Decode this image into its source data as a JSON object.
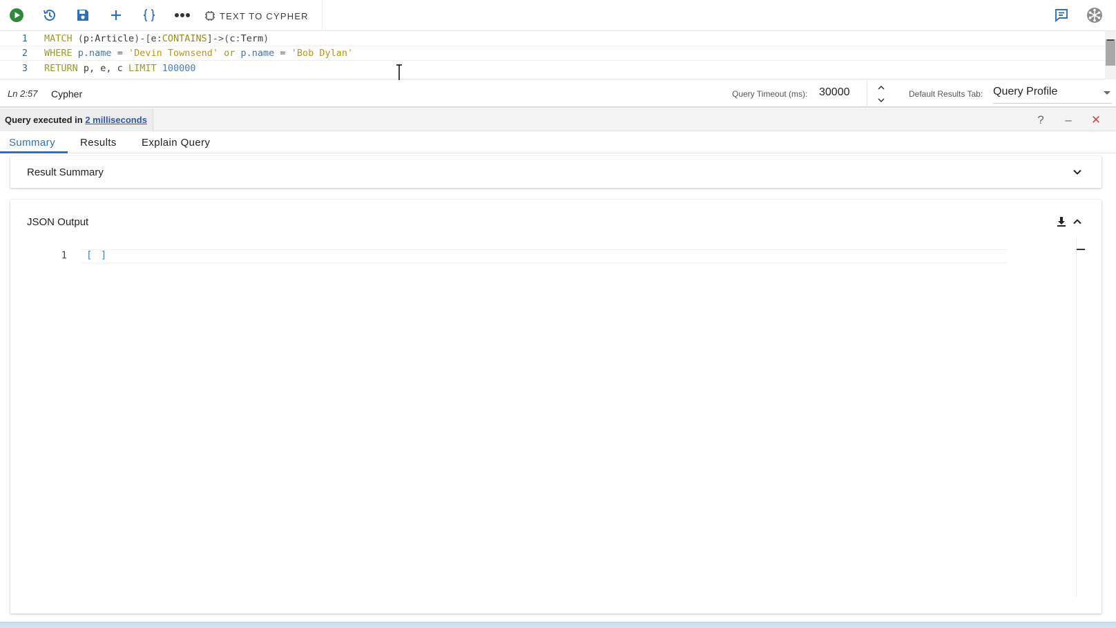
{
  "toolbar": {
    "text_to_cypher_label": "TEXT TO CYPHER",
    "accent_green": "#2e8b3e",
    "accent_blue": "#2e6fb5"
  },
  "editor": {
    "lines": [
      {
        "number": "1"
      },
      {
        "number": "2"
      },
      {
        "number": "3"
      }
    ],
    "line1": {
      "kw_match": "MATCH",
      "t1": " (",
      "var_p": "p",
      "colon1": ":",
      "label_article": "Article",
      "t2": ")-[",
      "var_e": "e",
      "colon2": ":",
      "label_contains": "CONTAINS",
      "t3": "]->(",
      "var_c": "c",
      "colon3": ":",
      "label_term": "Term",
      "t4": ")"
    },
    "line2": {
      "kw_where": "WHERE",
      "t1": " ",
      "prop1": "p.name",
      "eq1": " = ",
      "str1": "'Devin Townsend'",
      "kw_or": " or ",
      "prop2": "p.name",
      "eq2": " = ",
      "str2": "'Bob Dylan'"
    },
    "line3": {
      "kw_return": "RETURN",
      "vars": " p, e, c ",
      "kw_limit": "LIMIT",
      "sp": " ",
      "num": "100000"
    }
  },
  "statusbar": {
    "position": "Ln 2:57",
    "language": "Cypher",
    "timeout_label": "Query Timeout (ms):",
    "timeout_value": "30000",
    "default_tab_label": "Default Results Tab:",
    "default_tab_value": "Query Profile"
  },
  "results": {
    "exec_prefix": "Query executed in ",
    "exec_time": "2 milliseconds",
    "help_glyph": "?",
    "minimize_glyph": "–",
    "close_glyph": "✕"
  },
  "tabs": [
    {
      "label": "Summary",
      "active": true
    },
    {
      "label": "Results",
      "active": false
    },
    {
      "label": "Explain Query",
      "active": false
    }
  ],
  "panels": {
    "summary_title": "Result Summary",
    "json_title": "JSON Output",
    "json_line_number": "1",
    "json_content": "[ ]"
  }
}
